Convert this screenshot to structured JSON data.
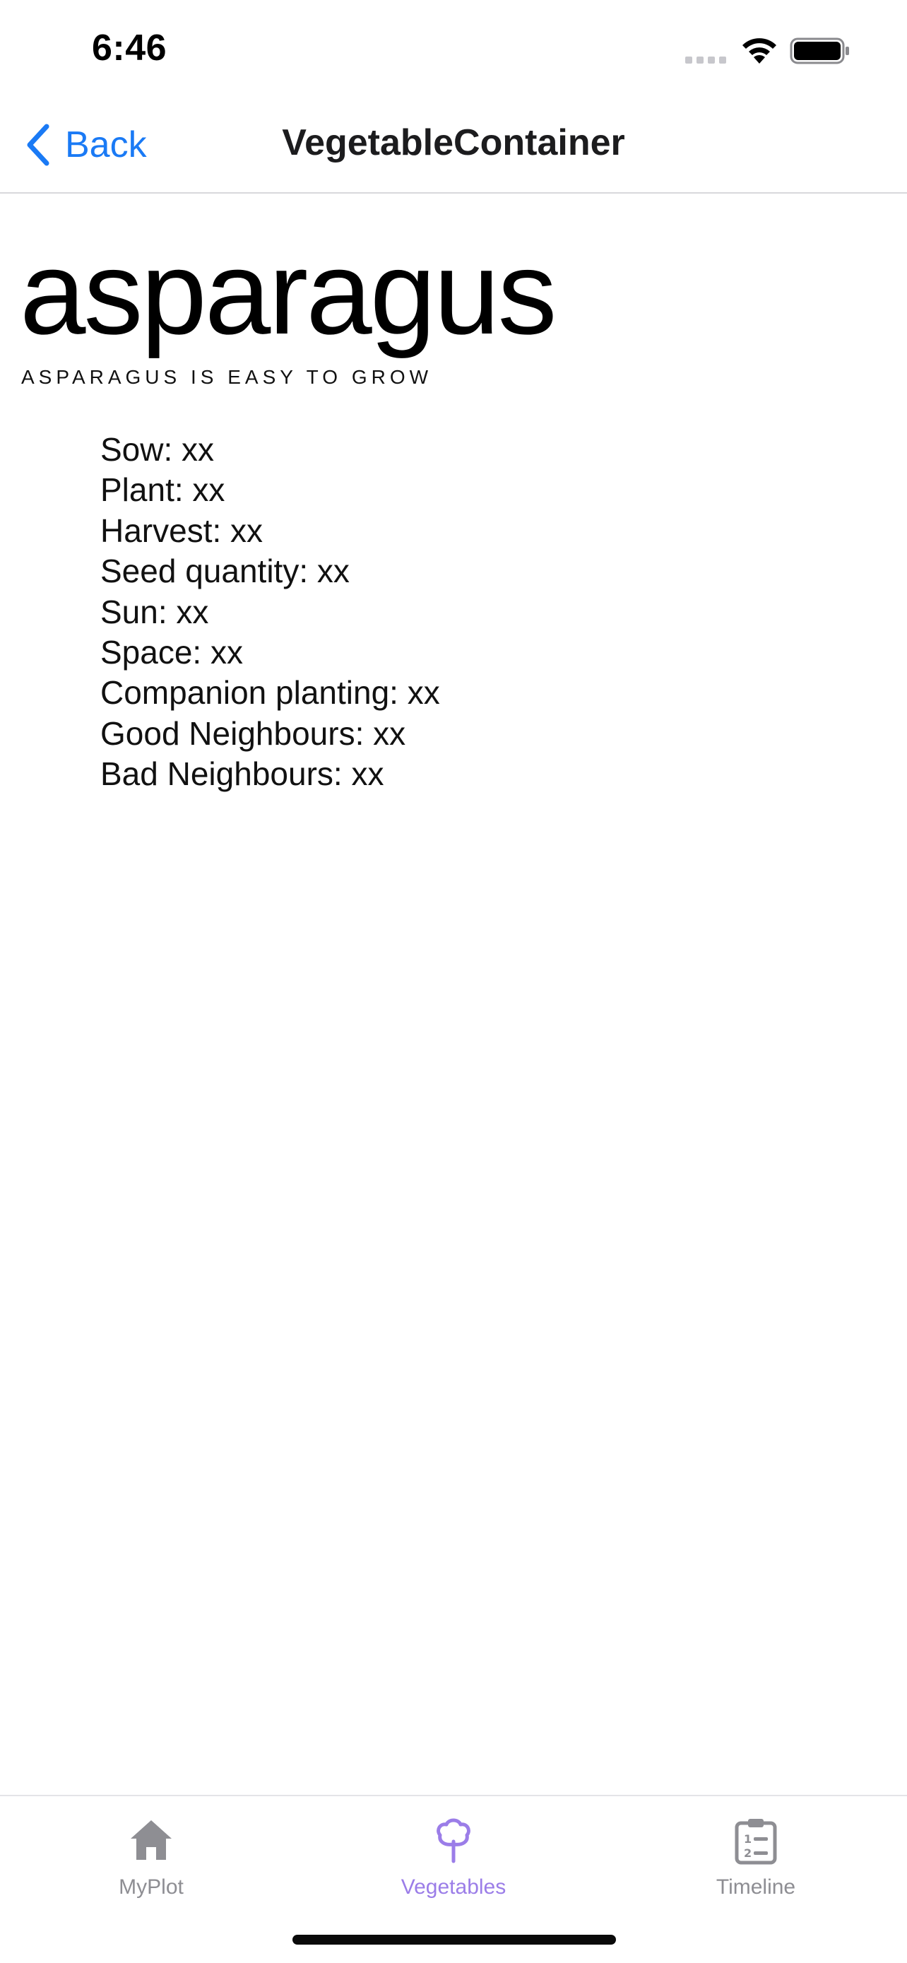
{
  "status_bar": {
    "time": "6:46",
    "wifi_icon": "wifi-icon",
    "battery_icon": "battery-icon"
  },
  "nav": {
    "back_label": "Back",
    "title": "VegetableContainer",
    "accent_color": "#1a7af5"
  },
  "vegetable": {
    "name": "asparagus",
    "subtitle": "ASPARAGUS IS EASY TO GROW",
    "details": [
      "Sow: xx",
      "Plant: xx",
      "Harvest: xx",
      "Seed quantity: xx",
      "Sun: xx",
      "Space: xx",
      "Companion planting: xx",
      "Good Neighbours: xx",
      "Bad Neighbours: xx"
    ]
  },
  "tab_bar": {
    "selected": "Vegetables",
    "selected_color": "#9b7de8",
    "unselected_color": "#8e8e93",
    "tabs": [
      {
        "label": "MyPlot",
        "icon": "house-icon"
      },
      {
        "label": "Vegetables",
        "icon": "tree-icon"
      },
      {
        "label": "Timeline",
        "icon": "clipboard-list-icon"
      }
    ]
  }
}
